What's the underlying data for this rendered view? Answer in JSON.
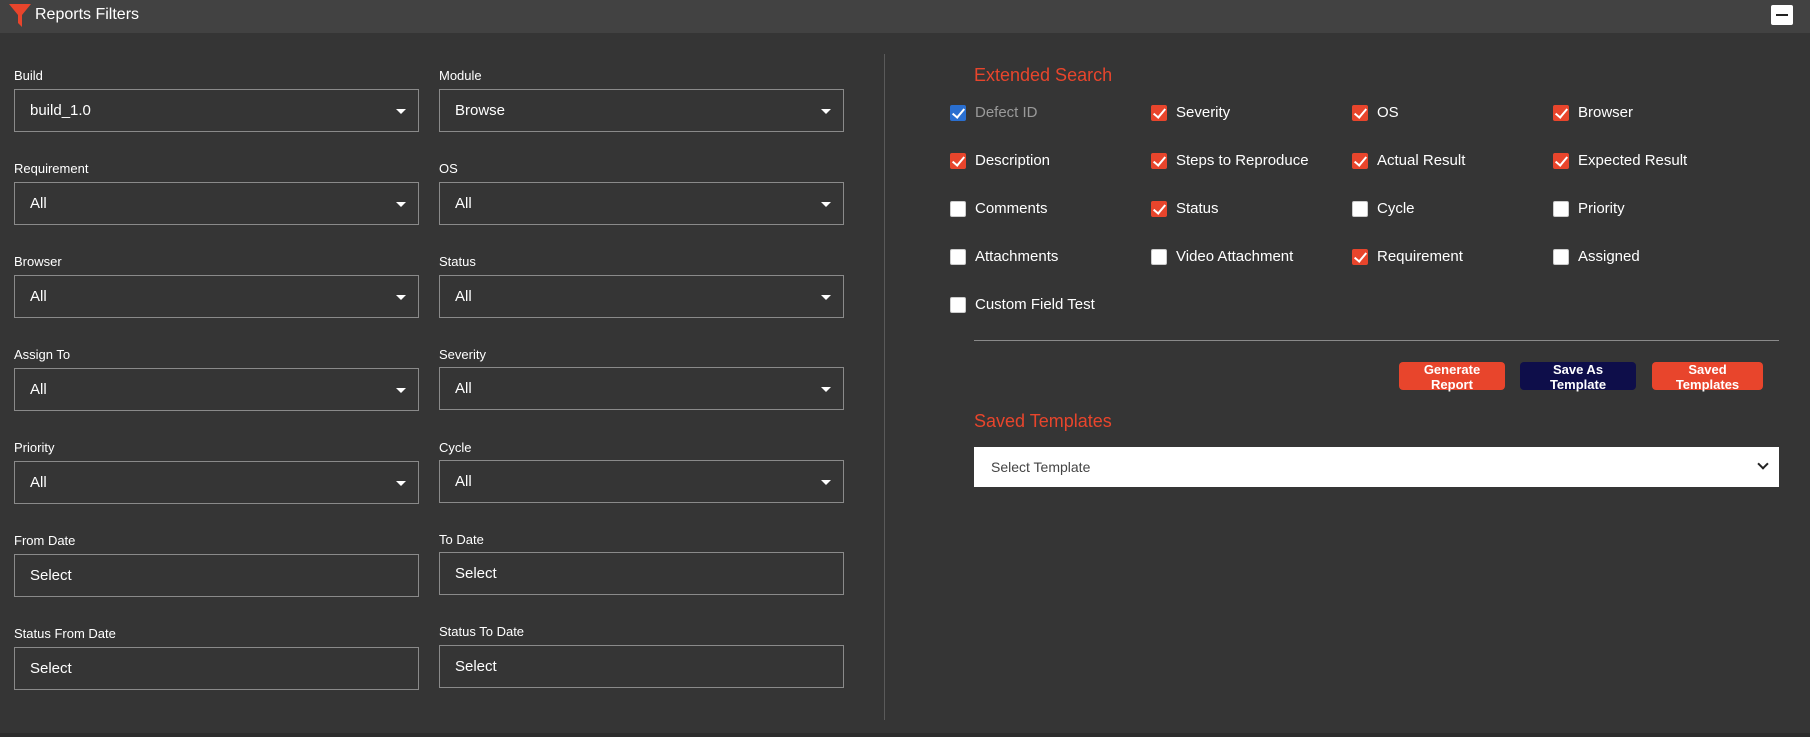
{
  "header": {
    "title": "Reports Filters",
    "icon": "funnel-icon",
    "accent": "#e8452c"
  },
  "filters": {
    "build": {
      "label": "Build",
      "value": "build_1.0"
    },
    "module": {
      "label": "Module",
      "value": "Browse"
    },
    "requirement": {
      "label": "Requirement",
      "value": "All"
    },
    "os": {
      "label": "OS",
      "value": "All"
    },
    "browser": {
      "label": "Browser",
      "value": "All"
    },
    "status": {
      "label": "Status",
      "value": "All"
    },
    "assign_to": {
      "label": "Assign To",
      "value": "All"
    },
    "severity": {
      "label": "Severity",
      "value": "All"
    },
    "priority": {
      "label": "Priority",
      "value": "All"
    },
    "cycle": {
      "label": "Cycle",
      "value": "All"
    },
    "from_date": {
      "label": "From Date",
      "value": "Select"
    },
    "to_date": {
      "label": "To Date",
      "value": "Select"
    },
    "status_from_date": {
      "label": "Status From Date",
      "value": "Select"
    },
    "status_to_date": {
      "label": "Status To Date",
      "value": "Select"
    }
  },
  "extended_search": {
    "title": "Extended Search",
    "fields": [
      {
        "label": "Defect ID",
        "checked": true,
        "disabled": true
      },
      {
        "label": "Severity",
        "checked": true
      },
      {
        "label": "OS",
        "checked": true
      },
      {
        "label": "Browser",
        "checked": true
      },
      {
        "label": "Description",
        "checked": true
      },
      {
        "label": "Steps to Reproduce",
        "checked": true
      },
      {
        "label": "Actual Result",
        "checked": true
      },
      {
        "label": "Expected Result",
        "checked": true
      },
      {
        "label": "Comments",
        "checked": false
      },
      {
        "label": "Status",
        "checked": true
      },
      {
        "label": "Cycle",
        "checked": false
      },
      {
        "label": "Priority",
        "checked": false
      },
      {
        "label": "Attachments",
        "checked": false
      },
      {
        "label": "Video Attachment",
        "checked": false
      },
      {
        "label": "Requirement",
        "checked": true
      },
      {
        "label": "Assigned",
        "checked": false
      },
      {
        "label": "Custom Field Test",
        "checked": false
      }
    ]
  },
  "actions": {
    "generate_report": "Generate Report",
    "save_as_template": "Save As Template",
    "saved_templates": "Saved Templates"
  },
  "saved_templates": {
    "title": "Saved Templates",
    "placeholder": "Select Template"
  }
}
